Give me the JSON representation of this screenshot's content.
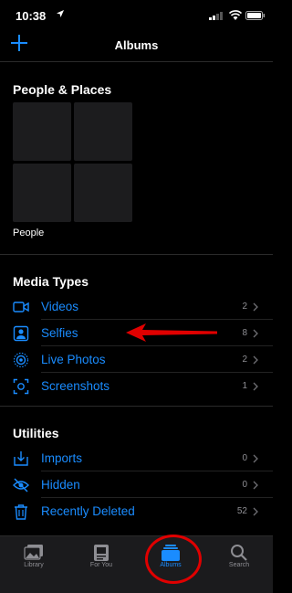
{
  "status": {
    "time": "10:38"
  },
  "nav": {
    "title": "Albums"
  },
  "people_places": {
    "title": "People & Places",
    "people_label": "People"
  },
  "media_types": {
    "title": "Media Types",
    "items": [
      {
        "label": "Videos",
        "count": "2",
        "icon": "video-icon"
      },
      {
        "label": "Selfies",
        "count": "8",
        "icon": "selfie-icon"
      },
      {
        "label": "Live Photos",
        "count": "2",
        "icon": "live-photo-icon"
      },
      {
        "label": "Screenshots",
        "count": "1",
        "icon": "screenshot-icon"
      }
    ]
  },
  "utilities": {
    "title": "Utilities",
    "items": [
      {
        "label": "Imports",
        "count": "0",
        "icon": "import-icon"
      },
      {
        "label": "Hidden",
        "count": "0",
        "icon": "hidden-icon"
      },
      {
        "label": "Recently Deleted",
        "count": "52",
        "icon": "trash-icon"
      }
    ]
  },
  "tabs": [
    {
      "label": "Library"
    },
    {
      "label": "For You"
    },
    {
      "label": "Albums",
      "active": true
    },
    {
      "label": "Search"
    }
  ],
  "colors": {
    "accent": "#1a8cff",
    "annotation": "#e00000"
  }
}
